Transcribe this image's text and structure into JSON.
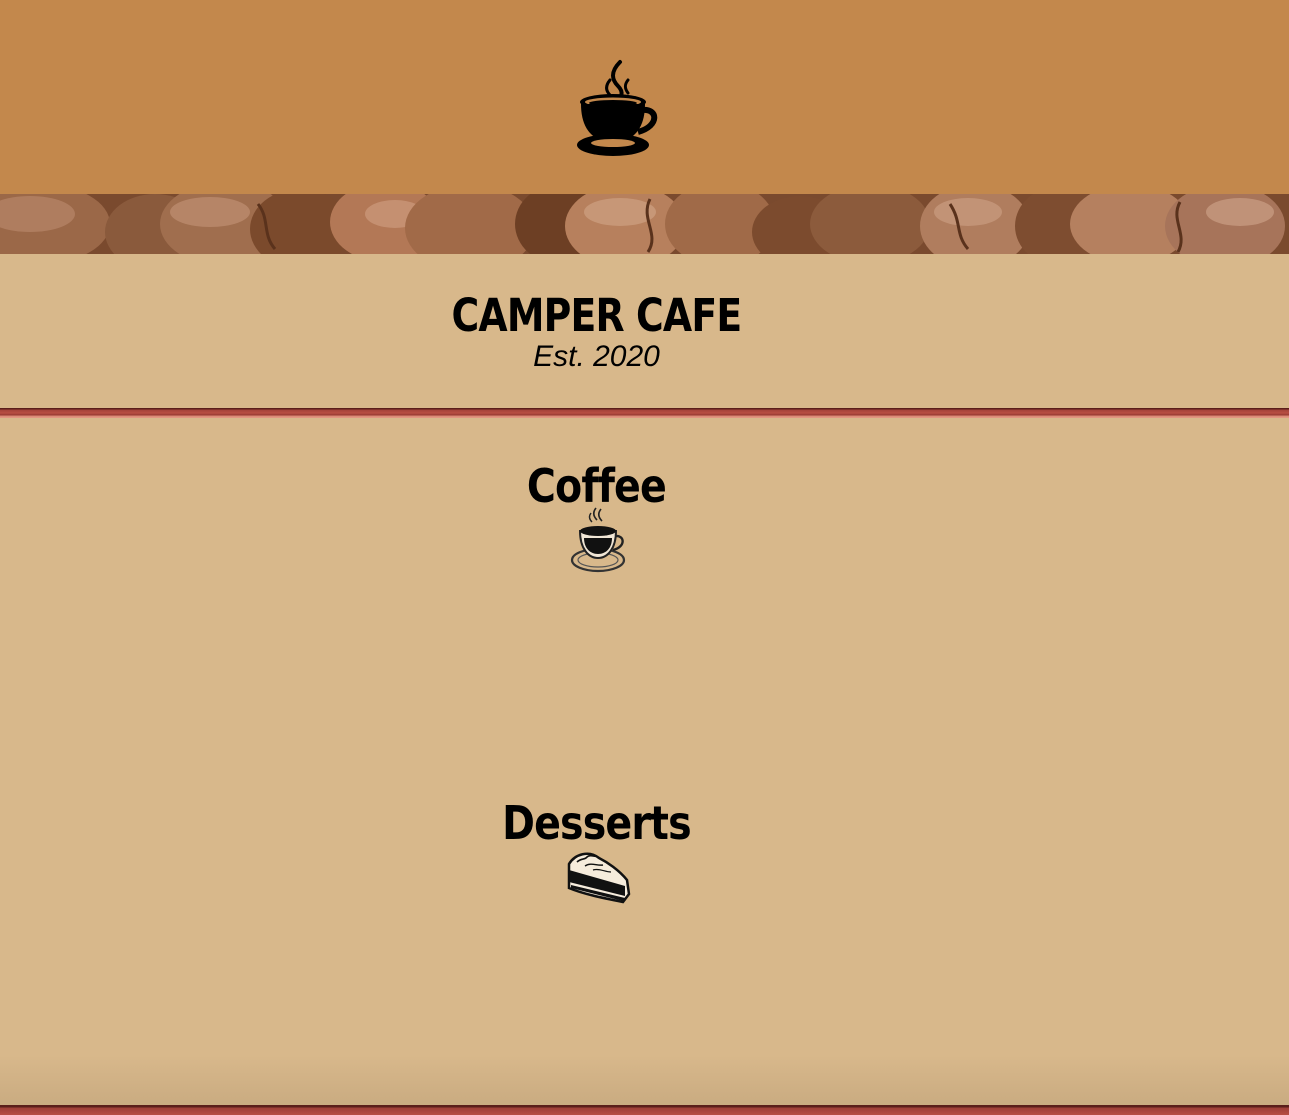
{
  "header": {
    "logo_icon": "coffee-cup-icon",
    "banner_image": "coffee-beans-banner",
    "title": "CAMPER CAFE",
    "established": "Est. 2020"
  },
  "menu": {
    "sections": [
      {
        "title": "Coffee",
        "icon": "coffee-cup-icon"
      },
      {
        "title": "Desserts",
        "icon": "pie-slice-icon"
      }
    ]
  },
  "colors": {
    "header_background": "#c3884c",
    "page_background": "#d8b88b",
    "divider": "#b84e43"
  }
}
